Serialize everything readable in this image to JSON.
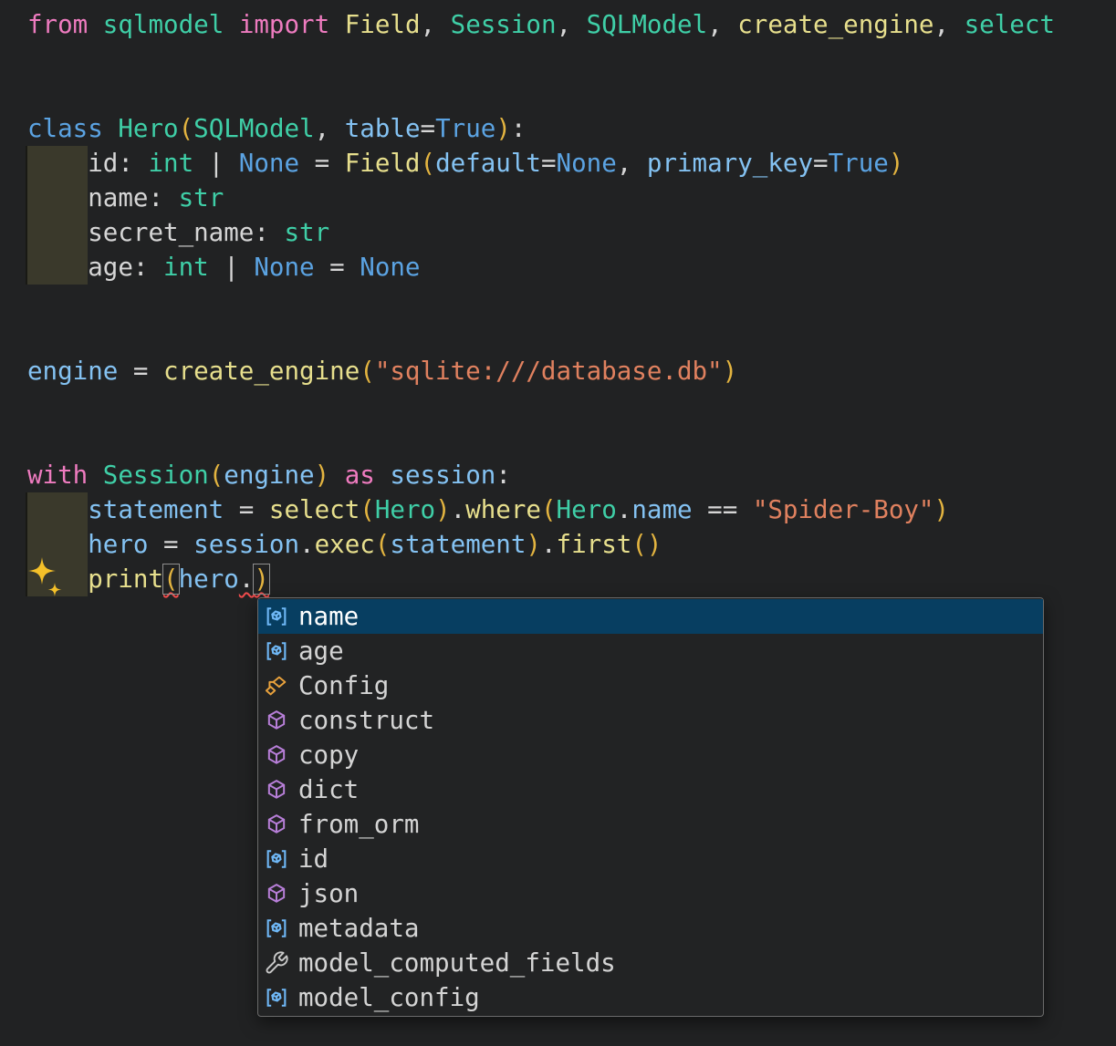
{
  "editor": {
    "background": "#212223",
    "syntax_colors": {
      "keyword": "#ee7bbf",
      "storage": "#5ba3e2",
      "constant": "#5ba3e2",
      "type": "#3fcfa7",
      "function": "#e7df8d",
      "variable": "#84c2f2",
      "string": "#e0815f",
      "bracket": "#e3b440",
      "plain": "#d6d6d6"
    },
    "lines": [
      {
        "segs": [
          [
            "from",
            "keyword"
          ],
          [
            " ",
            "plain"
          ],
          [
            "sqlmodel",
            "type"
          ],
          [
            " ",
            "plain"
          ],
          [
            "import",
            "keyword"
          ],
          [
            " ",
            "plain"
          ],
          [
            "Field",
            "function"
          ],
          [
            ", ",
            "plain"
          ],
          [
            "Session",
            "type"
          ],
          [
            ", ",
            "plain"
          ],
          [
            "SQLModel",
            "type"
          ],
          [
            ", ",
            "plain"
          ],
          [
            "create_engine",
            "function"
          ],
          [
            ", ",
            "plain"
          ],
          [
            "select",
            "type"
          ]
        ]
      },
      {
        "segs": []
      },
      {
        "segs": []
      },
      {
        "segs": [
          [
            "class",
            "storage"
          ],
          [
            " ",
            "plain"
          ],
          [
            "Hero",
            "type"
          ],
          [
            "(",
            "bracket"
          ],
          [
            "SQLModel",
            "type"
          ],
          [
            ", ",
            "plain"
          ],
          [
            "table",
            "variable"
          ],
          [
            "=",
            "plain"
          ],
          [
            "True",
            "constant"
          ],
          [
            ")",
            "bracket"
          ],
          [
            ":",
            "plain"
          ]
        ]
      },
      {
        "segs": [
          [
            "    id: ",
            "plain"
          ],
          [
            "int",
            "type"
          ],
          [
            " | ",
            "plain"
          ],
          [
            "None",
            "constant"
          ],
          [
            " = ",
            "plain"
          ],
          [
            "Field",
            "function"
          ],
          [
            "(",
            "bracket"
          ],
          [
            "default",
            "variable"
          ],
          [
            "=",
            "plain"
          ],
          [
            "None",
            "constant"
          ],
          [
            ", ",
            "plain"
          ],
          [
            "primary_key",
            "variable"
          ],
          [
            "=",
            "plain"
          ],
          [
            "True",
            "constant"
          ],
          [
            ")",
            "bracket"
          ]
        ]
      },
      {
        "segs": [
          [
            "    name: ",
            "plain"
          ],
          [
            "str",
            "type"
          ]
        ]
      },
      {
        "segs": [
          [
            "    secret_name: ",
            "plain"
          ],
          [
            "str",
            "type"
          ]
        ]
      },
      {
        "segs": [
          [
            "    age: ",
            "plain"
          ],
          [
            "int",
            "type"
          ],
          [
            " | ",
            "plain"
          ],
          [
            "None",
            "constant"
          ],
          [
            " = ",
            "plain"
          ],
          [
            "None",
            "constant"
          ]
        ]
      },
      {
        "segs": []
      },
      {
        "segs": []
      },
      {
        "segs": [
          [
            "engine",
            "variable"
          ],
          [
            " = ",
            "plain"
          ],
          [
            "create_engine",
            "function"
          ],
          [
            "(",
            "bracket"
          ],
          [
            "\"sqlite:///database.db\"",
            "string"
          ],
          [
            ")",
            "bracket"
          ]
        ]
      },
      {
        "segs": []
      },
      {
        "segs": []
      },
      {
        "segs": [
          [
            "with",
            "keyword"
          ],
          [
            " ",
            "plain"
          ],
          [
            "Session",
            "type"
          ],
          [
            "(",
            "bracket"
          ],
          [
            "engine",
            "variable"
          ],
          [
            ")",
            "bracket"
          ],
          [
            " ",
            "plain"
          ],
          [
            "as",
            "keyword"
          ],
          [
            " ",
            "plain"
          ],
          [
            "session",
            "variable"
          ],
          [
            ":",
            "plain"
          ]
        ]
      },
      {
        "segs": [
          [
            "    ",
            "plain"
          ],
          [
            "statement",
            "variable"
          ],
          [
            " = ",
            "plain"
          ],
          [
            "select",
            "function"
          ],
          [
            "(",
            "bracket"
          ],
          [
            "Hero",
            "type"
          ],
          [
            ")",
            "bracket"
          ],
          [
            ".",
            "plain"
          ],
          [
            "where",
            "function"
          ],
          [
            "(",
            "bracket"
          ],
          [
            "Hero",
            "type"
          ],
          [
            ".",
            "plain"
          ],
          [
            "name",
            "variable"
          ],
          [
            " == ",
            "plain"
          ],
          [
            "\"Spider-Boy\"",
            "string"
          ],
          [
            ")",
            "bracket"
          ]
        ]
      },
      {
        "segs": [
          [
            "    ",
            "plain"
          ],
          [
            "hero",
            "variable"
          ],
          [
            " = ",
            "plain"
          ],
          [
            "session",
            "variable"
          ],
          [
            ".",
            "plain"
          ],
          [
            "exec",
            "function"
          ],
          [
            "(",
            "bracket"
          ],
          [
            "statement",
            "variable"
          ],
          [
            ")",
            "bracket"
          ],
          [
            ".",
            "plain"
          ],
          [
            "first",
            "function"
          ],
          [
            "(",
            "bracket"
          ],
          [
            ")",
            "bracket"
          ]
        ]
      },
      {
        "segs": [
          [
            "    ",
            "plain"
          ],
          [
            "print",
            "function"
          ],
          [
            "(",
            "bracket",
            "boxed squiggle"
          ],
          [
            "hero",
            "variable"
          ],
          [
            ".",
            "plain",
            "squiggle"
          ],
          [
            ")",
            "bracket",
            "boxed squiggle"
          ]
        ]
      }
    ]
  },
  "decorations": {
    "indent_highlight_color": "#3a392b",
    "bracket_match_border": "#8f8f8f",
    "error_squiggle_color": "#f14c4c",
    "sparkle_color": "#f4c029",
    "selection_background": "#073e61"
  },
  "suggest": {
    "selected_index": 0,
    "kind_colors": {
      "field": "#6fb8f7",
      "class": "#e8a13c",
      "method": "#b87fd9",
      "property": "#c8c8c8"
    },
    "items": [
      {
        "label": "name",
        "kind": "field"
      },
      {
        "label": "age",
        "kind": "field"
      },
      {
        "label": "Config",
        "kind": "class"
      },
      {
        "label": "construct",
        "kind": "method"
      },
      {
        "label": "copy",
        "kind": "method"
      },
      {
        "label": "dict",
        "kind": "method"
      },
      {
        "label": "from_orm",
        "kind": "method"
      },
      {
        "label": "id",
        "kind": "field"
      },
      {
        "label": "json",
        "kind": "method"
      },
      {
        "label": "metadata",
        "kind": "field"
      },
      {
        "label": "model_computed_fields",
        "kind": "property"
      },
      {
        "label": "model_config",
        "kind": "field"
      }
    ]
  }
}
